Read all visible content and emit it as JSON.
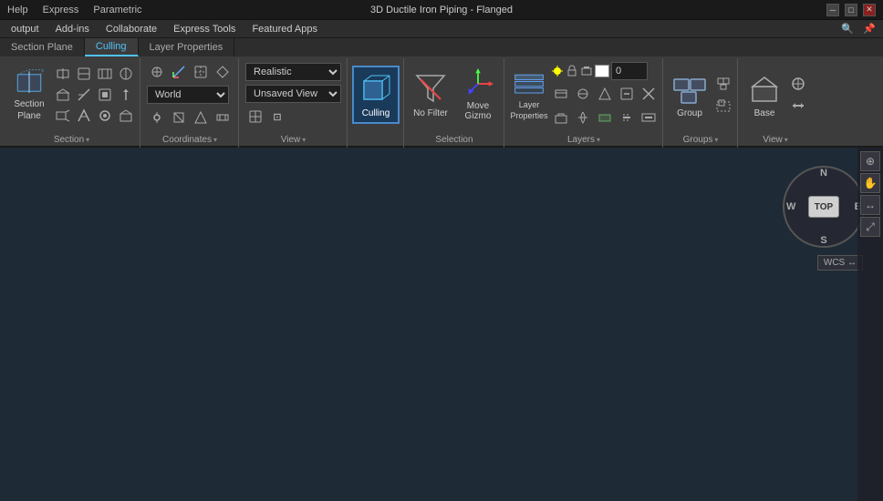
{
  "titleBar": {
    "title": "3D Ductile Iron Piping - Flanged",
    "menuItems": [
      "Help",
      "Express",
      "Parametric",
      "3D Ductile Iron Piping - Flanged"
    ],
    "winButtons": [
      "-",
      "□",
      "✕"
    ]
  },
  "menuBar": {
    "items": [
      "output",
      "Add-ins",
      "Collaborate",
      "Express Tools",
      "Featured Apps"
    ]
  },
  "ribbon": {
    "tabs": [
      {
        "label": "Section Plane",
        "active": false
      },
      {
        "label": "Culling",
        "active": true
      },
      {
        "label": "Layer Properties",
        "active": false
      }
    ],
    "groups": {
      "section": {
        "label": "Section",
        "hasArrow": true
      },
      "coordinates": {
        "label": "Coordinates",
        "hasArrow": true,
        "worldLabel": "World"
      },
      "view": {
        "label": "View",
        "hasArrow": true,
        "realisticLabel": "Realistic",
        "unsavedViewLabel": "Unsaved View"
      },
      "culling": {
        "label": "Culling",
        "active": true
      },
      "selection": {
        "label": "Selection",
        "noFilterLabel": "No Filter",
        "moveGizmoLabel": "Move Gizmo"
      },
      "layers": {
        "label": "Layers",
        "hasArrow": true,
        "layerPropsLabel": "Layer Properties",
        "layerInputValue": "0"
      },
      "groups": {
        "label": "Groups",
        "hasArrow": true,
        "groupLabel": "Group"
      },
      "viewRight": {
        "label": "View",
        "hasArrow": true,
        "baseLabel": "Base"
      }
    }
  },
  "viewport": {
    "background": "#1e2a35"
  },
  "compass": {
    "n": "N",
    "s": "S",
    "e": "E",
    "w": "W",
    "topLabel": "TOP"
  },
  "wcs": {
    "label": "WCS ↔"
  },
  "navTools": {
    "tools": [
      "⊕",
      "🖐",
      "↔",
      "⤢"
    ]
  }
}
